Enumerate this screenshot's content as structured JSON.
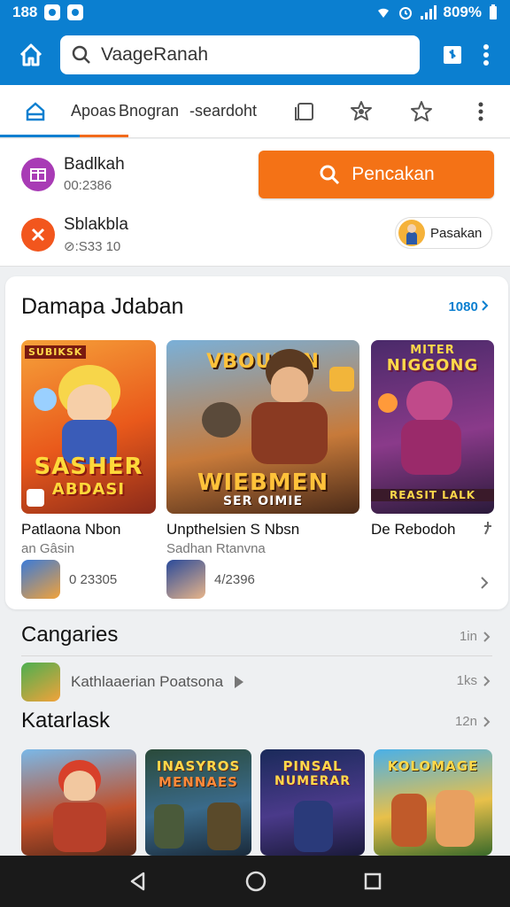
{
  "status": {
    "time": "188",
    "battery": "809%",
    "icons": [
      "notification-icon",
      "notification-icon",
      "wifi-icon",
      "alarm-icon",
      "signal-icon",
      "battery-icon"
    ]
  },
  "appbar": {
    "search_value": "VaageRanah",
    "icons": [
      "home-icon",
      "search-icon",
      "bookmark-icon",
      "more-vert-icon"
    ]
  },
  "tabs": {
    "items": [
      {
        "label": ""
      },
      {
        "label": "Apoas"
      },
      {
        "label": "Bnogran"
      },
      {
        "label": "-seardoht"
      }
    ]
  },
  "quick": {
    "item1": {
      "title": "Badlkah",
      "sub": "00:2386"
    },
    "item2": {
      "title": "Sblakbla",
      "sub": "⊘:S33 10"
    },
    "search_button": "Pencakan",
    "pesan_button": "Pasakan"
  },
  "featured": {
    "title": "Damapa Jdaban",
    "more": "1080",
    "games": [
      {
        "art_text": "SASHER",
        "art_text2": "ABDASI",
        "badge": "SUBIKSK",
        "title": "Patlaona Nbon",
        "sub": "an Gâsin"
      },
      {
        "art_text": "VBOUKEN",
        "art_text2": "WIEBMEN",
        "art_text3": "SER OIMIE",
        "title": "Unpthelsien S Nbsn",
        "sub": "Sadhan Rtanvna"
      },
      {
        "art_text": "MITER",
        "art_text2": "NIGGONG",
        "art_text3": "REASIT LALK",
        "title": "De Rebodoh",
        "sub": ""
      }
    ],
    "stats": [
      {
        "value": "0 23305"
      },
      {
        "value": "4/2396"
      }
    ]
  },
  "categories": {
    "title": "Cangaries",
    "count": "1in",
    "item_label": "Kathlaaerian Poatsona",
    "item_count": "1ks"
  },
  "latest": {
    "title": "Katarlask",
    "count": "12n",
    "cards": [
      {
        "label": ""
      },
      {
        "label": "INASYROS",
        "label2": "MENNAES"
      },
      {
        "label": "PINSAL",
        "label2": "NUMERAR"
      },
      {
        "label": "KOLOMAGE"
      }
    ]
  },
  "colors": {
    "primary": "#0b7fd0",
    "accent": "#f47216"
  }
}
